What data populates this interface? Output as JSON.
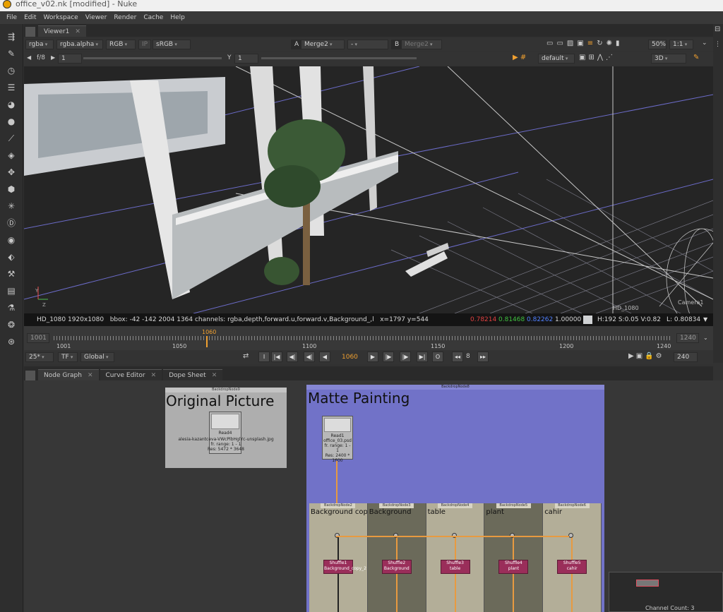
{
  "window": {
    "title": "office_v02.nk [modified] - Nuke"
  },
  "menu": [
    "File",
    "Edit",
    "Workspace",
    "Viewer",
    "Render",
    "Cache",
    "Help"
  ],
  "viewer": {
    "tab_label": "Viewer1",
    "channels": "rgba",
    "alpha": "rgba.alpha",
    "display": "RGB",
    "ip": "IP",
    "colorspace": "sRGB",
    "a_label": "A",
    "a_input": "Merge2",
    "mid_input": "-",
    "b_label": "B",
    "b_input": "Merge2",
    "zoom": "50%",
    "ratio": "1:1",
    "fstop": "f/8",
    "fstop_value": "1",
    "y_label": "Y",
    "y_value": "1",
    "lut": "default",
    "view_mode": "3D",
    "format_label": "HD_1080",
    "camera_label": "Camera1"
  },
  "info": {
    "format": "HD_1080 1920x1080",
    "bbox": "bbox: -42 -142 2004 1364",
    "channels": "channels: rgba,depth,forward.u,forward.v,Background_,l",
    "coords": "x=1797 y=544",
    "r": "0.78214",
    "g": "0.81468",
    "b": "0.82262",
    "a": "1.00000",
    "hsv": "H:192 S:0.05 V:0.82",
    "lum": "L: 0.80834"
  },
  "timeline": {
    "start": "1001",
    "end": "1240",
    "current": "1060",
    "ticks": [
      "1001",
      "1050",
      "1100",
      "1150",
      "1200",
      "1240"
    ],
    "fps": "25*",
    "tf": "TF",
    "scope": "Global",
    "step": "8",
    "frame_count": "240",
    "current_field": "1060"
  },
  "nodegraph": {
    "tabs": [
      "Node Graph",
      "Curve Editor",
      "Dope Sheet"
    ],
    "backdrop9": {
      "header": "BackdropNode9",
      "title": "Original Picture"
    },
    "read4": {
      "name": "Read4",
      "file": "alesia-kazantceva-VWcPlbHglYc-unsplash.jpg",
      "range": "fr. range: 1 - 1",
      "res": "Res: 5472 * 3648"
    },
    "backdrop8": {
      "header": "BackdropNode8",
      "title": "Matte Painting"
    },
    "read1": {
      "name": "Read1",
      "file": "office_03.psd",
      "range": "fr. range: 1 - 1",
      "res": "Res: 2400 * 1600"
    },
    "columns": [
      {
        "header": "BackdropNode2",
        "title": "Background copy",
        "node": "Shuffle1",
        "sub": "Background_copy_2",
        "color": "#b3ae98"
      },
      {
        "header": "BackdropNode3",
        "title": "Background",
        "node": "Shuffle2",
        "sub": "Background",
        "color": "#6b6a5a"
      },
      {
        "header": "BackdropNode4",
        "title": "table",
        "node": "Shuffle3",
        "sub": "table",
        "color": "#b3ae98"
      },
      {
        "header": "BackdropNode5",
        "title": "plant",
        "node": "Shuffle4",
        "sub": "plant",
        "color": "#6b6a5a"
      },
      {
        "header": "BackdropNode6",
        "title": "cahir",
        "node": "Shuffle5",
        "sub": "cahir",
        "color": "#b3ae98"
      }
    ],
    "channel_count": "Channel Count: 3"
  }
}
